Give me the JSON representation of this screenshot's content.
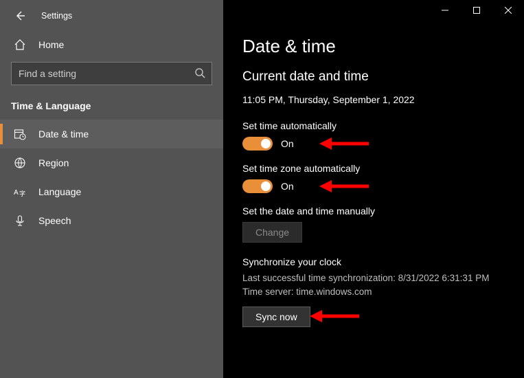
{
  "window": {
    "title": "Settings"
  },
  "sidebar": {
    "home": "Home",
    "search_placeholder": "Find a setting",
    "section": "Time & Language",
    "items": [
      {
        "label": "Date & time"
      },
      {
        "label": "Region"
      },
      {
        "label": "Language"
      },
      {
        "label": "Speech"
      }
    ]
  },
  "page": {
    "title": "Date & time",
    "subhead": "Current date and time",
    "current": "11:05 PM, Thursday, September 1, 2022",
    "set_time_auto_label": "Set time automatically",
    "set_time_auto_state": "On",
    "set_tz_auto_label": "Set time zone automatically",
    "set_tz_auto_state": "On",
    "manual_label": "Set the date and time manually",
    "change_btn": "Change",
    "sync_head": "Synchronize your clock",
    "sync_last": "Last successful time synchronization: 8/31/2022 6:31:31 PM",
    "sync_server": "Time server: time.windows.com",
    "sync_btn": "Sync now"
  },
  "colors": {
    "accent": "#e98f3a",
    "arrow": "#ff0000"
  }
}
